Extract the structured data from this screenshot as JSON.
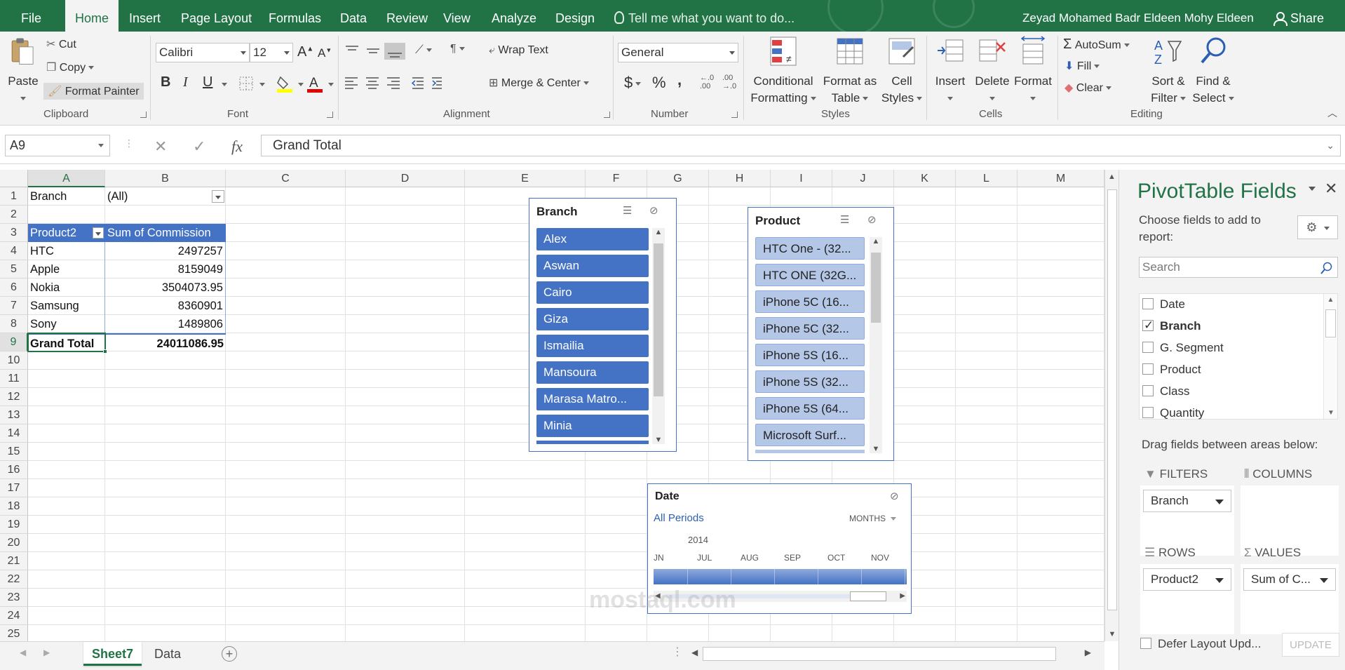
{
  "tabs": {
    "file": "File",
    "home": "Home",
    "insert": "Insert",
    "page_layout": "Page Layout",
    "formulas": "Formulas",
    "data": "Data",
    "review": "Review",
    "view": "View",
    "analyze": "Analyze",
    "design": "Design"
  },
  "tell_me": "Tell me what you want to do...",
  "user_name": "Zeyad Mohamed Badr Eldeen Mohy Eldeen",
  "share": "Share",
  "ribbon": {
    "paste": "Paste",
    "cut": "Cut",
    "copy": "Copy",
    "format_painter": "Format Painter",
    "clipboard": "Clipboard",
    "font_name": "Calibri",
    "font_size": "12",
    "font_group": "Font",
    "bold": "B",
    "italic": "I",
    "underline": "U",
    "wrap_text": "Wrap Text",
    "merge_center": "Merge & Center",
    "alignment": "Alignment",
    "number_format": "General",
    "currency": "$",
    "percent": "%",
    "comma": ",",
    "number_group": "Number",
    "conditional_formatting": [
      "Conditional",
      "Formatting"
    ],
    "format_as_table": [
      "Format as",
      "Table"
    ],
    "cell_styles": [
      "Cell",
      "Styles"
    ],
    "styles_group": "Styles",
    "insert": "Insert",
    "delete": "Delete",
    "format": "Format",
    "cells_group": "Cells",
    "autosum": "AutoSum",
    "fill": "Fill",
    "clear": "Clear",
    "sort_filter": [
      "Sort &",
      "Filter"
    ],
    "find_select": [
      "Find &",
      "Select"
    ],
    "editing_group": "Editing"
  },
  "formula_bar": {
    "name_box": "A9",
    "formula": "Grand Total",
    "fx": "fx"
  },
  "columns": [
    "A",
    "B",
    "C",
    "D",
    "E",
    "F",
    "G",
    "H",
    "I",
    "J",
    "K",
    "L",
    "M"
  ],
  "rows": [
    "1",
    "2",
    "3",
    "4",
    "5",
    "6",
    "7",
    "8",
    "9",
    "10",
    "11",
    "12",
    "13",
    "14",
    "15",
    "16",
    "17",
    "18",
    "19",
    "20",
    "21",
    "22",
    "23",
    "24",
    "25"
  ],
  "pivot": {
    "filter_label": "Branch",
    "filter_value": "(All)",
    "row_header": "Product2",
    "value_header": "Sum of Commission",
    "items": [
      {
        "label": "HTC",
        "value": "2497257"
      },
      {
        "label": "Apple",
        "value": "8159049"
      },
      {
        "label": "Nokia",
        "value": "3504073.95"
      },
      {
        "label": "Samsung",
        "value": "8360901"
      },
      {
        "label": "Sony",
        "value": "1489806"
      }
    ],
    "total_label": "Grand Total",
    "total_value": "24011086.95"
  },
  "slicer_branch": {
    "title": "Branch",
    "items": [
      "Alex",
      "Aswan",
      "Cairo",
      "Giza",
      "Ismailia",
      "Mansoura",
      "Marasa Matro...",
      "Minia"
    ]
  },
  "slicer_product": {
    "title": "Product",
    "items": [
      "HTC One - (32...",
      "HTC ONE (32G...",
      "iPhone 5C (16...",
      "iPhone 5C (32...",
      "iPhone 5S (16...",
      "iPhone 5S (32...",
      "iPhone 5S (64...",
      "Microsoft Surf..."
    ]
  },
  "timeline": {
    "title": "Date",
    "all_periods": "All Periods",
    "level": "MONTHS",
    "year": "2014",
    "months": [
      "JN",
      "JUL",
      "AUG",
      "SEP",
      "OCT",
      "NOV"
    ]
  },
  "sheets": [
    "Sheet7",
    "Data"
  ],
  "pane": {
    "title": "PivotTable Fields",
    "subtitle": "Choose fields to add to report:",
    "search_placeholder": "Search",
    "fields": [
      {
        "name": "Date",
        "checked": false
      },
      {
        "name": "Branch",
        "checked": true
      },
      {
        "name": "G. Segment",
        "checked": false
      },
      {
        "name": "Product",
        "checked": false
      },
      {
        "name": "Class",
        "checked": false
      },
      {
        "name": "Quantity",
        "checked": false
      }
    ],
    "drag_label": "Drag fields between areas below:",
    "filters": "FILTERS",
    "columns": "COLUMNS",
    "rows": "ROWS",
    "values": "VALUES",
    "filter_item": "Branch",
    "row_item": "Product2",
    "value_item": "Sum of C...",
    "defer": "Defer Layout Upd...",
    "update": "UPDATE"
  },
  "colors": {
    "excel_green": "#217346",
    "pivot_blue": "#4472c4",
    "slicer_light": "#b4c7e7"
  }
}
